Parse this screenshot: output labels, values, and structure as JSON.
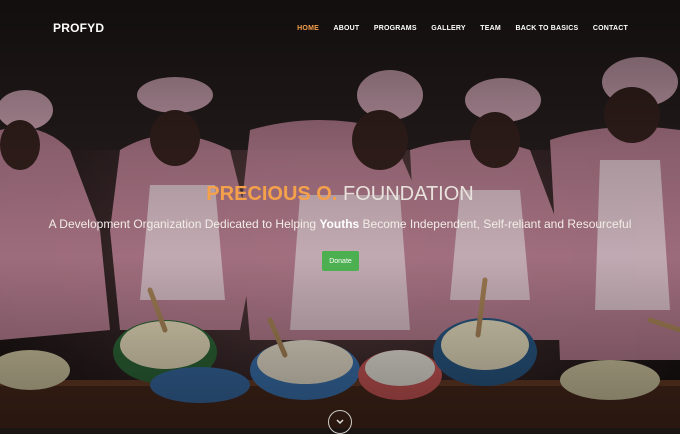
{
  "brand": "PROFYD",
  "nav": [
    {
      "label": "HOME",
      "active": true
    },
    {
      "label": "ABOUT",
      "active": false
    },
    {
      "label": "PROGRAMS",
      "active": false
    },
    {
      "label": "GALLERY",
      "active": false
    },
    {
      "label": "TEAM",
      "active": false
    },
    {
      "label": "BACK TO BASICS",
      "active": false
    },
    {
      "label": "CONTACT",
      "active": false
    }
  ],
  "hero": {
    "title_accent": "PRECIOUS O.",
    "title_rest": " FOUNDATION",
    "tagline_before": "A Development Organization Dedicated to Helping ",
    "tagline_bold": "Youths",
    "tagline_after": " Become Independent, Self-reliant and Resourceful",
    "donate_label": "Donate"
  },
  "colors": {
    "accent": "#f5a04a",
    "donate": "#4caf50"
  }
}
